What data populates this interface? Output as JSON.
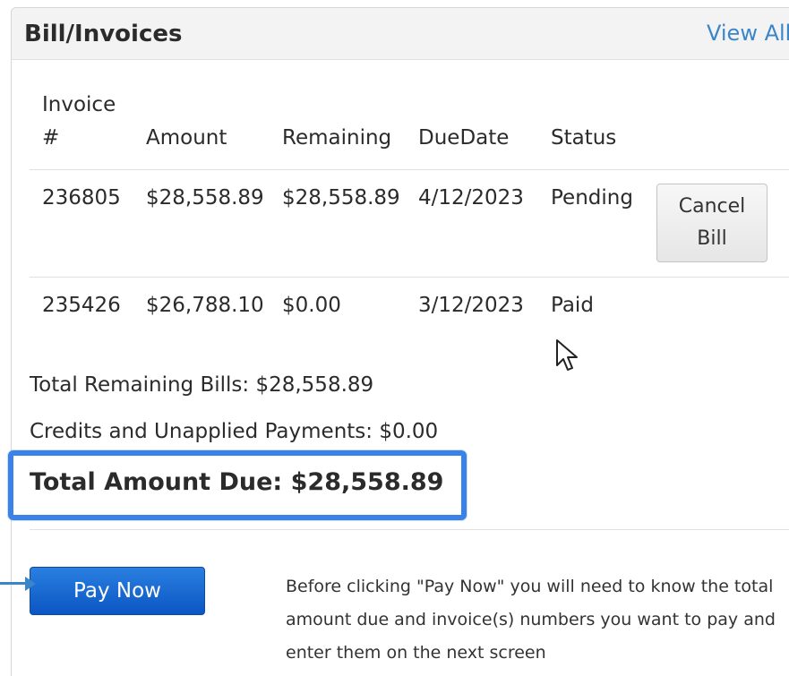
{
  "panel": {
    "title": "Bill/Invoices",
    "view_all_label": "View All"
  },
  "table": {
    "headers": [
      "Invoice #",
      "Amount",
      "Remaining",
      "DueDate",
      "Status"
    ],
    "header_invoice_line1": "Invoice",
    "header_invoice_line2": "#",
    "rows": [
      {
        "invoice": "236805",
        "amount": "$28,558.89",
        "remaining": "$28,558.89",
        "due_date": "4/12/2023",
        "status": "Pending",
        "action_label_line1": "Cancel",
        "action_label_line2": "Bill"
      },
      {
        "invoice": "235426",
        "amount": "$26,788.10",
        "remaining": "$0.00",
        "due_date": "3/12/2023",
        "status": "Paid"
      }
    ]
  },
  "summary": {
    "total_remaining": "Total Remaining Bills: $28,558.89",
    "credits": "Credits and Unapplied Payments: $0.00",
    "total_due": "Total Amount Due: $28,558.89"
  },
  "pay": {
    "button_label": "Pay Now",
    "note_line1": "Before clicking \"Pay Now\" you will need to know the total",
    "note_line2": "amount due and invoice(s) numbers you want to pay and",
    "note_line3": "enter them on the next screen"
  },
  "colors": {
    "link": "#3b86c9",
    "highlight": "#3b82e8",
    "pay_button": "#0b56c4"
  },
  "icons": {
    "cursor": "mouse-pointer-icon",
    "arrow": "arrow-right-icon"
  }
}
